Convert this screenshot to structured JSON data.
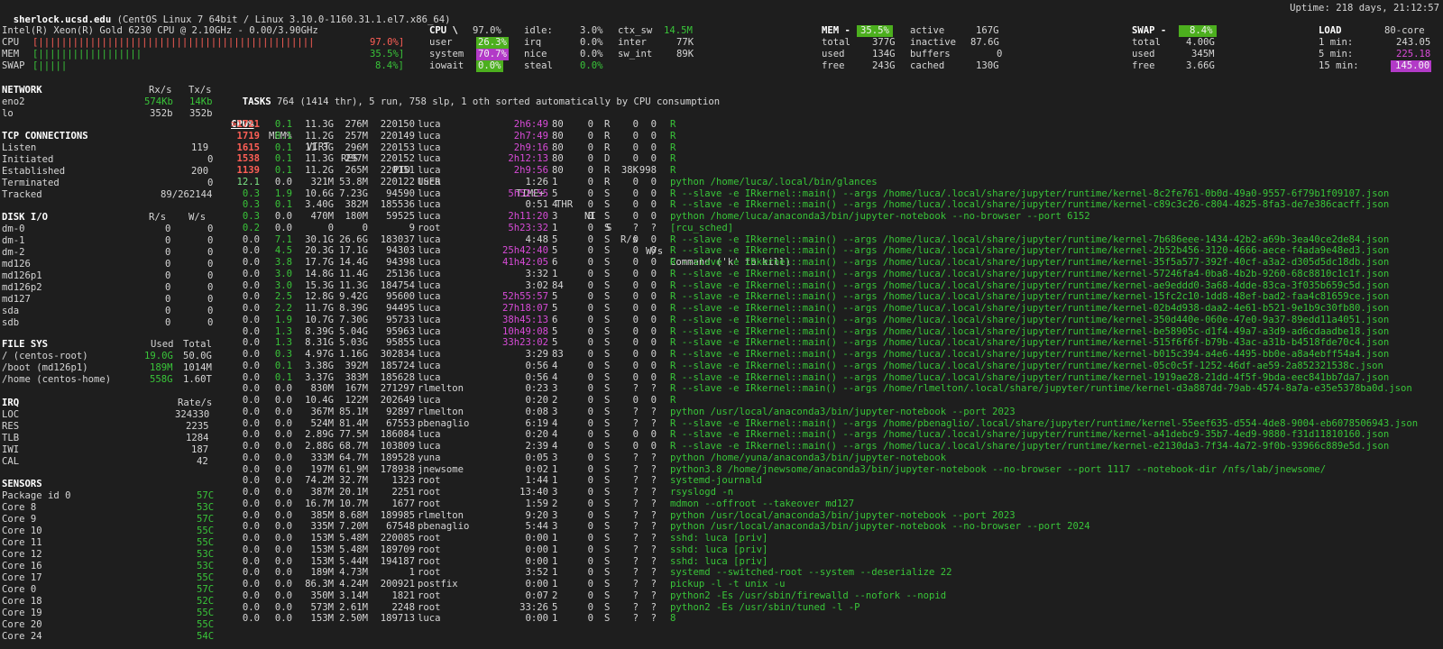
{
  "header": {
    "host": "sherlock.ucsd.edu",
    "os": "(CentOS Linux 7 64bit / Linux 3.10.0-1160.31.1.el7.x86_64)",
    "uptime": "Uptime: 218 days, 21:12:57"
  },
  "quicklook": {
    "cpu_model": "Intel(R) Xeon(R) Gold 6230 CPU @ 2.10GHz - 0.00/3.90GHz",
    "bars": [
      {
        "label": "CPU",
        "bar": "[||||||||||||||||||||||||||||||||||||||||||||||||",
        "value": "97.0%]",
        "fraction": 0.97
      },
      {
        "label": "MEM",
        "bar": "[||||||||||||||||||",
        "value": "35.5%]",
        "fraction": 0.355
      },
      {
        "label": "SWAP",
        "bar": "[|||||",
        "value": "8.4%]",
        "fraction": 0.084
      }
    ]
  },
  "cpu": {
    "title": "CPU \\",
    "total": "97.0%",
    "rows": [
      [
        "user",
        "26.3%",
        "irq",
        "0.0%",
        "inter",
        "77K"
      ],
      [
        "system",
        "70.7%",
        "nice",
        "0.0%",
        "sw_int",
        "89K"
      ],
      [
        "iowait",
        "0.0%",
        "steal",
        "0.0%",
        "",
        ""
      ]
    ],
    "idle_label": "idle:",
    "idle_value": "3.0%",
    "ctx_label": "ctx_sw",
    "ctx_value": "14.5M"
  },
  "mem": {
    "title": "MEM -",
    "pct": "35.5%",
    "rows": [
      [
        "total",
        "377G",
        "inactive",
        "87.6G"
      ],
      [
        "used",
        "134G",
        "buffers",
        "0"
      ],
      [
        "free",
        "243G",
        "cached",
        "130G"
      ]
    ],
    "active_label": "active",
    "active_value": "167G"
  },
  "swap": {
    "title": "SWAP -",
    "pct": "8.4%",
    "rows": [
      [
        "total",
        "4.00G"
      ],
      [
        "used",
        "345M"
      ],
      [
        "free",
        "3.66G"
      ]
    ]
  },
  "load": {
    "title": "LOAD",
    "cores": "80-core",
    "rows": [
      [
        "1 min:",
        "243.05"
      ],
      [
        "5 min:",
        "225.18"
      ],
      [
        "15 min:",
        "145.00"
      ]
    ]
  },
  "network": {
    "title": "NETWORK",
    "rx": "Rx/s",
    "tx": "Tx/s",
    "rows": [
      [
        "eno2",
        "574Kb",
        "14Kb"
      ],
      [
        "lo",
        "352b",
        "352b"
      ]
    ]
  },
  "tcp": {
    "title": "TCP CONNECTIONS",
    "rows": [
      [
        "Listen",
        "119"
      ],
      [
        "Initiated",
        "0"
      ],
      [
        "Established",
        "200"
      ],
      [
        "Terminated",
        "0"
      ],
      [
        "Tracked",
        "89/262144"
      ]
    ]
  },
  "disk": {
    "title": "DISK I/O",
    "r": "R/s",
    "w": "W/s",
    "rows": [
      [
        "dm-0",
        "0",
        "0"
      ],
      [
        "dm-1",
        "0",
        "0"
      ],
      [
        "dm-2",
        "0",
        "0"
      ],
      [
        "md126",
        "0",
        "0"
      ],
      [
        "md126p1",
        "0",
        "0"
      ],
      [
        "md126p2",
        "0",
        "0"
      ],
      [
        "md127",
        "0",
        "0"
      ],
      [
        "sda",
        "0",
        "0"
      ],
      [
        "sdb",
        "0",
        "0"
      ]
    ]
  },
  "fs": {
    "title": "FILE SYS",
    "used": "Used",
    "total": "Total",
    "rows": [
      [
        "/ (centos-root)",
        "19.0G",
        "50.0G"
      ],
      [
        "/boot (md126p1)",
        "189M",
        "1014M"
      ],
      [
        "/home (centos-home)",
        "558G",
        "1.60T"
      ]
    ]
  },
  "irq": {
    "title": "IRQ",
    "rate": "Rate/s",
    "rows": [
      [
        "LOC",
        "324330"
      ],
      [
        "RES",
        "2235"
      ],
      [
        "TLB",
        "1284"
      ],
      [
        "IWI",
        "187"
      ],
      [
        "CAL",
        "42"
      ]
    ]
  },
  "sensors": {
    "title": "SENSORS",
    "rows": [
      [
        "Package id 0",
        "57C"
      ],
      [
        "Core 8",
        "53C"
      ],
      [
        "Core 9",
        "57C"
      ],
      [
        "Core 10",
        "55C"
      ],
      [
        "Core 11",
        "55C"
      ],
      [
        "Core 12",
        "53C"
      ],
      [
        "Core 16",
        "53C"
      ],
      [
        "Core 17",
        "55C"
      ],
      [
        "Core 0",
        "57C"
      ],
      [
        "Core 18",
        "52C"
      ],
      [
        "Core 19",
        "55C"
      ],
      [
        "Core 20",
        "55C"
      ],
      [
        "Core 24",
        "54C"
      ]
    ]
  },
  "tasks": {
    "label": "TASKS",
    "summary": "764 (1414 thr), 5 run, 758 slp, 1 oth sorted automatically by CPU consumption",
    "cols": [
      "CPU%",
      "MEM%",
      "VIRT",
      "RES",
      "PID",
      "USER",
      "TIME+",
      "THR",
      "NI",
      "S",
      "R/s",
      "W/s",
      "Command ('k' to kill)"
    ],
    "rows": [
      [
        ">1721",
        "0.1",
        "11.3G",
        "276M",
        "220150",
        "luca",
        "2h6:49",
        "80",
        "0",
        "R",
        "0",
        "0",
        "R"
      ],
      [
        "1719",
        "0.1",
        "11.2G",
        "257M",
        "220149",
        "luca",
        "2h7:49",
        "80",
        "0",
        "R",
        "0",
        "0",
        "R"
      ],
      [
        "1615",
        "0.1",
        "11.3G",
        "296M",
        "220153",
        "luca",
        "2h9:16",
        "80",
        "0",
        "R",
        "0",
        "0",
        "R"
      ],
      [
        "1538",
        "0.1",
        "11.3G",
        "297M",
        "220152",
        "luca",
        "2h12:13",
        "80",
        "0",
        "D",
        "0",
        "0",
        "R"
      ],
      [
        "1139",
        "0.1",
        "11.2G",
        "265M",
        "220151",
        "luca",
        "2h9:56",
        "80",
        "0",
        "R",
        "38K",
        "998",
        "R"
      ],
      [
        "12.1",
        "0.0",
        "321M",
        "53.8M",
        "220122",
        "luca",
        "1:26",
        "1",
        "0",
        "R",
        "0",
        "0",
        "python /home/luca/.local/bin/glances"
      ],
      [
        "0.3",
        "1.9",
        "10.6G",
        "7.23G",
        "94590",
        "luca",
        "5h52:55",
        "5",
        "0",
        "S",
        "0",
        "0",
        "R --slave -e IRkernel::main() --args /home/luca/.local/share/jupyter/runtime/kernel-8c2fe761-0b0d-49a0-9557-6f79b1f09107.json"
      ],
      [
        "0.3",
        "0.1",
        "3.40G",
        "382M",
        "185536",
        "luca",
        "0:51",
        "4",
        "0",
        "S",
        "0",
        "0",
        "R --slave -e IRkernel::main() --args /home/luca/.local/share/jupyter/runtime/kernel-c89c3c26-c804-4825-8fa3-de7e386cacff.json"
      ],
      [
        "0.3",
        "0.0",
        "470M",
        "180M",
        "59525",
        "luca",
        "2h11:20",
        "3",
        "0",
        "S",
        "0",
        "0",
        "python /home/luca/anaconda3/bin/jupyter-notebook --no-browser --port 6152"
      ],
      [
        "0.2",
        "0.0",
        "0",
        "0",
        "9",
        "root",
        "5h23:32",
        "1",
        "0",
        "S",
        "?",
        "?",
        "[rcu_sched]"
      ],
      [
        "0.0",
        "7.1",
        "30.1G",
        "26.6G",
        "183037",
        "luca",
        "4:48",
        "5",
        "0",
        "S",
        "0",
        "0",
        "R --slave -e IRkernel::main() --args /home/luca/.local/share/jupyter/runtime/kernel-7b686eee-1434-42b2-a69b-3ea40ce2de84.json"
      ],
      [
        "0.0",
        "4.5",
        "20.3G",
        "17.1G",
        "94303",
        "luca",
        "25h42:40",
        "5",
        "0",
        "S",
        "0",
        "0",
        "R --slave -e IRkernel::main() --args /home/luca/.local/share/jupyter/runtime/kernel-2b52b456-3120-4666-aece-f4ada9e48ed3.json"
      ],
      [
        "0.0",
        "3.8",
        "17.7G",
        "14.4G",
        "94398",
        "luca",
        "41h42:05",
        "6",
        "0",
        "S",
        "0",
        "0",
        "R --slave -e IRkernel::main() --args /home/luca/.local/share/jupyter/runtime/kernel-35f5a577-392f-40cf-a3a2-d305d5dc18db.json"
      ],
      [
        "0.0",
        "3.0",
        "14.8G",
        "11.4G",
        "25136",
        "luca",
        "3:32",
        "1",
        "0",
        "S",
        "0",
        "0",
        "R --slave -e IRkernel::main() --args /home/luca/.local/share/jupyter/runtime/kernel-57246fa4-0ba8-4b2b-9260-68c8810c1c1f.json"
      ],
      [
        "0.0",
        "3.0",
        "15.3G",
        "11.3G",
        "184754",
        "luca",
        "3:02",
        "84",
        "0",
        "S",
        "0",
        "0",
        "R --slave -e IRkernel::main() --args /home/luca/.local/share/jupyter/runtime/kernel-ae9eddd0-3a68-4dde-83ca-3f035b659c5d.json"
      ],
      [
        "0.0",
        "2.5",
        "12.8G",
        "9.42G",
        "95600",
        "luca",
        "52h55:57",
        "5",
        "0",
        "S",
        "0",
        "0",
        "R --slave -e IRkernel::main() --args /home/luca/.local/share/jupyter/runtime/kernel-15fc2c10-1dd8-48ef-bad2-faa4c81659ce.json"
      ],
      [
        "0.0",
        "2.2",
        "11.7G",
        "8.39G",
        "94495",
        "luca",
        "27h18:07",
        "5",
        "0",
        "S",
        "0",
        "0",
        "R --slave -e IRkernel::main() --args /home/luca/.local/share/jupyter/runtime/kernel-02b4d938-daa2-4e61-b521-9e1b9c30fb80.json"
      ],
      [
        "0.0",
        "1.9",
        "10.7G",
        "7.30G",
        "95733",
        "luca",
        "38h45:13",
        "6",
        "0",
        "S",
        "0",
        "0",
        "R --slave -e IRkernel::main() --args /home/luca/.local/share/jupyter/runtime/kernel-350d440e-060e-47e0-9a37-89edd11a4051.json"
      ],
      [
        "0.0",
        "1.3",
        "8.39G",
        "5.04G",
        "95963",
        "luca",
        "10h49:08",
        "5",
        "0",
        "S",
        "0",
        "0",
        "R --slave -e IRkernel::main() --args /home/luca/.local/share/jupyter/runtime/kernel-be58905c-d1f4-49a7-a3d9-ad6cdaadbe18.json"
      ],
      [
        "0.0",
        "1.3",
        "8.31G",
        "5.03G",
        "95855",
        "luca",
        "33h23:02",
        "5",
        "0",
        "S",
        "0",
        "0",
        "R --slave -e IRkernel::main() --args /home/luca/.local/share/jupyter/runtime/kernel-515f6f6f-b79b-43ac-a31b-b4518fde70c4.json"
      ],
      [
        "0.0",
        "0.3",
        "4.97G",
        "1.16G",
        "302834",
        "luca",
        "3:29",
        "83",
        "0",
        "S",
        "0",
        "0",
        "R --slave -e IRkernel::main() --args /home/luca/.local/share/jupyter/runtime/kernel-b015c394-a4e6-4495-bb0e-a8a4ebff54a4.json"
      ],
      [
        "0.0",
        "0.1",
        "3.38G",
        "392M",
        "185724",
        "luca",
        "0:56",
        "4",
        "0",
        "S",
        "0",
        "0",
        "R --slave -e IRkernel::main() --args /home/luca/.local/share/jupyter/runtime/kernel-05c0c5f-1252-46df-ae59-2a852321538c.json"
      ],
      [
        "0.0",
        "0.1",
        "3.37G",
        "383M",
        "185628",
        "luca",
        "0:56",
        "4",
        "0",
        "S",
        "0",
        "0",
        "R --slave -e IRkernel::main() --args /home/luca/.local/share/jupyter/runtime/kernel-1919ae28-21dd-4f5f-9bda-eec841bb7da7.json"
      ],
      [
        "0.0",
        "0.0",
        "830M",
        "167M",
        "271297",
        "rlmelton",
        "0:23",
        "3",
        "0",
        "S",
        "?",
        "?",
        "R --slave -e IRkernel::main() --args /home/rlmelton/.local/share/jupyter/runtime/kernel-d3a887dd-79ab-4574-8a7a-e35e5378ba0d.json"
      ],
      [
        "0.0",
        "0.0",
        "10.4G",
        "122M",
        "202649",
        "luca",
        "0:20",
        "2",
        "0",
        "S",
        "0",
        "0",
        "R"
      ],
      [
        "0.0",
        "0.0",
        "367M",
        "85.1M",
        "92897",
        "rlmelton",
        "0:08",
        "3",
        "0",
        "S",
        "?",
        "?",
        "python /usr/local/anaconda3/bin/jupyter-notebook --port 2023"
      ],
      [
        "0.0",
        "0.0",
        "524M",
        "81.4M",
        "67553",
        "pbenaglio",
        "6:19",
        "4",
        "0",
        "S",
        "?",
        "?",
        "R --slave -e IRkernel::main() --args /home/pbenaglio/.local/share/jupyter/runtime/kernel-55eef635-d554-4de8-9004-eb6078506943.json"
      ],
      [
        "0.0",
        "0.0",
        "2.89G",
        "77.5M",
        "186084",
        "luca",
        "0:20",
        "4",
        "0",
        "S",
        "0",
        "0",
        "R --slave -e IRkernel::main() --args /home/luca/.local/share/jupyter/runtime/kernel-a41debc9-35b7-4ed9-9880-f31d11810160.json"
      ],
      [
        "0.0",
        "0.0",
        "2.88G",
        "68.7M",
        "103809",
        "luca",
        "2:39",
        "4",
        "0",
        "S",
        "0",
        "0",
        "R --slave -e IRkernel::main() --args /home/luca/.local/share/jupyter/runtime/kernel-e2130da3-7f34-4a72-9f0b-93966c889e5d.json"
      ],
      [
        "0.0",
        "0.0",
        "333M",
        "64.7M",
        "189528",
        "yuna",
        "0:05",
        "3",
        "0",
        "S",
        "?",
        "?",
        "python /home/yuna/anaconda3/bin/jupyter-notebook"
      ],
      [
        "0.0",
        "0.0",
        "197M",
        "61.9M",
        "178938",
        "jnewsome",
        "0:02",
        "1",
        "0",
        "S",
        "?",
        "?",
        "python3.8 /home/jnewsome/anaconda3/bin/jupyter-notebook --no-browser --port 1117 --notebook-dir /nfs/lab/jnewsome/"
      ],
      [
        "0.0",
        "0.0",
        "74.2M",
        "32.7M",
        "1323",
        "root",
        "1:44",
        "1",
        "0",
        "S",
        "?",
        "?",
        "systemd-journald"
      ],
      [
        "0.0",
        "0.0",
        "387M",
        "20.1M",
        "2251",
        "root",
        "13:40",
        "3",
        "0",
        "S",
        "?",
        "?",
        "rsyslogd -n"
      ],
      [
        "0.0",
        "0.0",
        "16.7M",
        "10.7M",
        "1677",
        "root",
        "1:59",
        "2",
        "0",
        "S",
        "?",
        "?",
        "mdmon --offroot --takeover md127"
      ],
      [
        "0.0",
        "0.0",
        "385M",
        "8.68M",
        "189985",
        "rlmelton",
        "9:20",
        "3",
        "0",
        "S",
        "?",
        "?",
        "python /usr/local/anaconda3/bin/jupyter-notebook --port 2023"
      ],
      [
        "0.0",
        "0.0",
        "335M",
        "7.20M",
        "67548",
        "pbenaglio",
        "5:44",
        "3",
        "0",
        "S",
        "?",
        "?",
        "python /usr/local/anaconda3/bin/jupyter-notebook --no-browser --port 2024"
      ],
      [
        "0.0",
        "0.0",
        "153M",
        "5.48M",
        "220085",
        "root",
        "0:00",
        "1",
        "0",
        "S",
        "?",
        "?",
        "sshd: luca [priv]"
      ],
      [
        "0.0",
        "0.0",
        "153M",
        "5.48M",
        "189709",
        "root",
        "0:00",
        "1",
        "0",
        "S",
        "?",
        "?",
        "sshd: luca [priv]"
      ],
      [
        "0.0",
        "0.0",
        "153M",
        "5.44M",
        "194187",
        "root",
        "0:00",
        "1",
        "0",
        "S",
        "?",
        "?",
        "sshd: luca [priv]"
      ],
      [
        "0.0",
        "0.0",
        "189M",
        "4.73M",
        "1",
        "root",
        "3:52",
        "1",
        "0",
        "S",
        "?",
        "?",
        "systemd --switched-root --system --deserialize 22"
      ],
      [
        "0.0",
        "0.0",
        "86.3M",
        "4.24M",
        "200921",
        "postfix",
        "0:00",
        "1",
        "0",
        "S",
        "?",
        "?",
        "pickup -l -t unix -u"
      ],
      [
        "0.0",
        "0.0",
        "350M",
        "3.14M",
        "1821",
        "root",
        "0:07",
        "2",
        "0",
        "S",
        "?",
        "?",
        "python2 -Es /usr/sbin/firewalld --nofork --nopid"
      ],
      [
        "0.0",
        "0.0",
        "573M",
        "2.61M",
        "2248",
        "root",
        "33:26",
        "5",
        "0",
        "S",
        "?",
        "?",
        "python2 -Es /usr/sbin/tuned -l -P"
      ],
      [
        "0.0",
        "0.0",
        "153M",
        "2.50M",
        "189713",
        "luca",
        "0:00",
        "1",
        "0",
        "S",
        "?",
        "?",
        "8"
      ]
    ]
  },
  "colors": {
    "background": "#1e1e1e",
    "green": "#39c539",
    "light_green": "#7ee787",
    "red": "#ff5f56",
    "magenta": "#d84bd8",
    "bar_green": "#4caf1e",
    "bar_magenta": "#b23ac7"
  }
}
